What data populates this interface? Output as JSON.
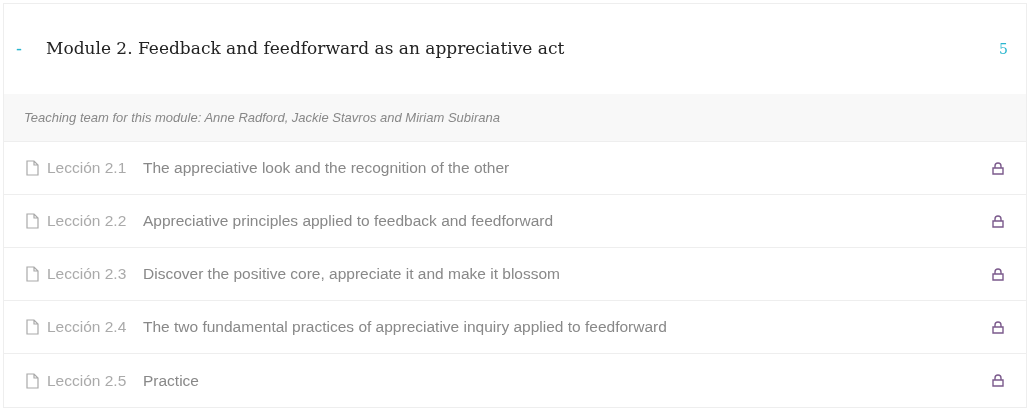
{
  "module": {
    "toggle": "-",
    "title": "Module 2. Feedback and feedforward as an appreciative act",
    "count": "5"
  },
  "team_note": "Teaching team for this module: Anne Radford, Jackie Stavros and Miriam Subirana",
  "lessons": [
    {
      "label": "Lección 2.1",
      "title": "The appreciative look and the recognition of the other",
      "locked": true
    },
    {
      "label": "Lección 2.2",
      "title": "Appreciative principles applied to feedback and feedforward",
      "locked": true
    },
    {
      "label": "Lección 2.3",
      "title": "Discover the positive core, appreciate it and make it blossom",
      "locked": true
    },
    {
      "label": "Lección 2.4",
      "title": "The two fundamental practices of appreciative inquiry applied to feedforward",
      "locked": true
    },
    {
      "label": "Lección 2.5",
      "title": "Practice",
      "locked": true
    }
  ]
}
